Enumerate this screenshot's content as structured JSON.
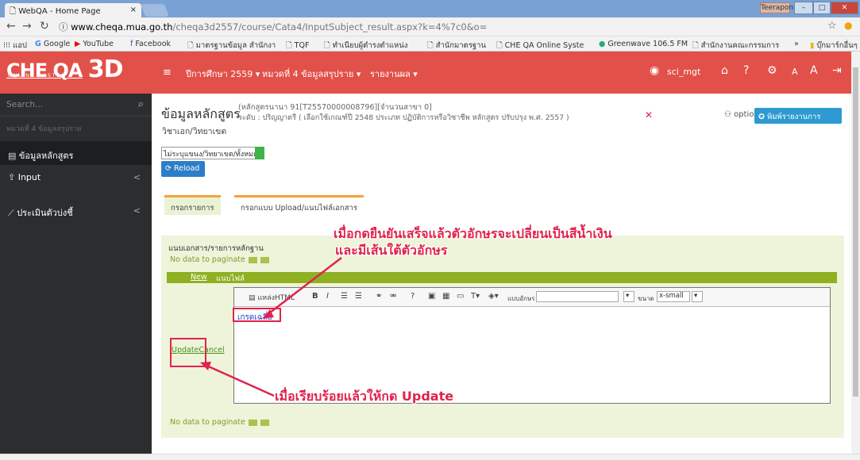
{
  "browser": {
    "tab_title": "WebQA - Home Page",
    "tab_close": "×",
    "window_user": "Teerapon",
    "url_host": "www.cheqa.mua.go.th",
    "url_path": "/cheqa3d2557/course/Cata4/InputSubject_result.aspx?k=4%7c0&o=",
    "bookmarks": [
      "แอป",
      "Google",
      "YouTube",
      "Facebook",
      "มาตรฐานข้อมูล สำนักงา",
      "TQF",
      "ทำเนียบผู้ตำรงตำแหน่ง",
      "สำนักมาตรฐาน",
      "CHE QA Online Syste",
      "Greenwave 106.5 FM",
      "สำนักงานคณะกรรมการ",
      "»",
      "บุ๊กมาร์กอื่นๆ"
    ]
  },
  "app": {
    "logo_main": "CHE QA",
    "logo_3d": "3D",
    "logo_sub": "ONLINE SYSTEM",
    "menu": [
      "ปีการศึกษา 2559 ▾",
      "หมวดที่ 4 ข้อมูลสรุปราย ▾",
      "รายงานผล ▾"
    ],
    "user": "sci_mgt",
    "colors": {
      "header": "#e2504a",
      "sidebar": "#2b2d2e",
      "accent_green": "#8eb021",
      "annotation": "#e0234c"
    }
  },
  "sidebar": {
    "search_placeholder": "Search...",
    "section": "หมวดที่ 4 ข้อมูลสรุปราย",
    "items": [
      {
        "label": "ข้อมูลหลักสูตร",
        "icon": "document-icon"
      },
      {
        "label": "Input",
        "icon": "upload-icon",
        "arrow": "<"
      },
      {
        "label": "ประเมินตัวบ่งชี้",
        "icon": "chart-line-icon",
        "arrow": "<"
      }
    ]
  },
  "main": {
    "title": "ข้อมูลหลักสูตร",
    "course_info_1": "(หลักสูตรนานา 91[T25570000008796][จำนวนสาขา 0]",
    "course_info_2": "ระดับ : ปริญญาตรี ( เลือกใช้เกณฑ์ปี 2548 ประเภท ปฏิบัติการหรือวิชาชีพ หลักสูตร ปรับปรุง พ.ศ. 2557 )",
    "major_line": "วิชาเอก/วิทยาเขต",
    "option_label": "option",
    "print_label": "พิมพ์รายงานการประเมินตนเอง",
    "select_value": "ไม่ระบุแขนง/วิทยาเขต/ทั้งหมด",
    "reload_label": "Reload",
    "tabs": [
      "กรอกรายการ",
      "กรอกแบบ Upload/แนบไฟล์เอกสาร"
    ],
    "panel_title": "แนบเอกสาร/รายการหลักฐาน",
    "paginate_text": "No data to paginate",
    "table_new": "New",
    "table_col": "แนบไฟล์",
    "editor_toolbar_labels": [
      "แหล่งHTML",
      "B",
      "I",
      "แบบอักษร",
      "ขนาด",
      "x-small"
    ],
    "editor_link_text": "เกรดเฉลี่ย",
    "update_label": "Update",
    "cancel_label": "Cancel"
  },
  "annotations": {
    "top_line1": "เมื่อกดยืนยันเสร็จแล้วตัวอักษรจะเปลี่ยนเป็นสีน้ำเงิน",
    "top_line2": "และมีเส้นใต้ตัวอักษร",
    "bottom": "เมื่อเรียบร้อยแล้วให้กด Update"
  }
}
